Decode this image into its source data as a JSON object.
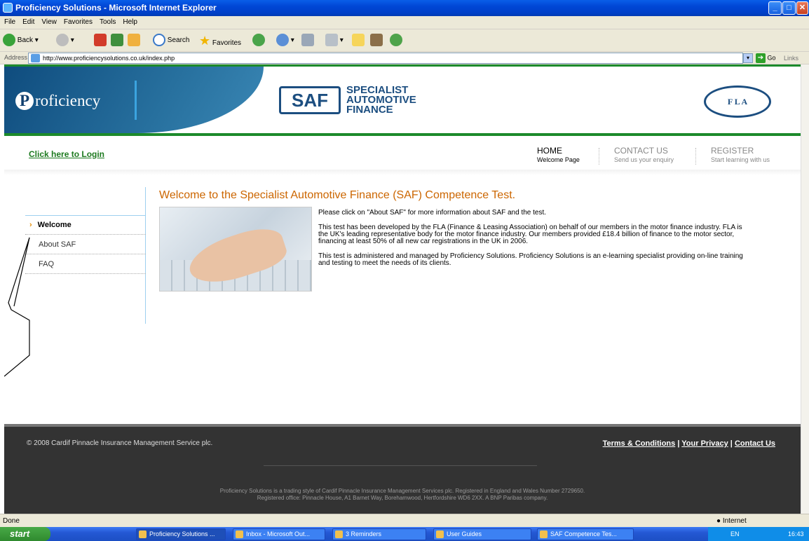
{
  "window": {
    "title": "Proficiency Solutions - Microsoft Internet Explorer"
  },
  "menu": [
    "File",
    "Edit",
    "View",
    "Favorites",
    "Tools",
    "Help"
  ],
  "toolbar": {
    "back": "Back",
    "search": "Search",
    "favorites": "Favorites"
  },
  "address": {
    "label": "Address",
    "url": "http://www.proficiencysolutions.co.uk/index.php",
    "go": "Go",
    "links": "Links"
  },
  "header": {
    "proficiency": "roficiency",
    "proficiency_initial": "P",
    "saf_logo": "SAF",
    "saf_line1": "SPECIALIST",
    "saf_line2": "AUTOMOTIVE",
    "saf_line3": "FINANCE",
    "fla": "F  L  A"
  },
  "login": "Click here to Login",
  "nav": [
    {
      "label": "HOME",
      "sub": "Welcome Page"
    },
    {
      "label": "CONTACT US",
      "sub": "Send us your enquiry"
    },
    {
      "label": "REGISTER",
      "sub": "Start learning with us"
    }
  ],
  "sidemenu": [
    {
      "label": "Welcome"
    },
    {
      "label": "About SAF"
    },
    {
      "label": "FAQ"
    }
  ],
  "main": {
    "heading": "Welcome to the Specialist Automotive Finance (SAF) Competence Test.",
    "p1": "Please click on \"About SAF\" for more information about SAF and the test.",
    "p2": "This test has been developed by the FLA (Finance & Leasing Association) on behalf of our members in the motor finance industry. FLA is the UK's leading representative body for the motor finance industry. Our members provided £18.4 billion of finance to the motor sector, financing at least 50% of all new car registrations in the UK in 2006.",
    "p3": "This test is administered and managed by Proficiency Solutions. Proficiency Solutions is an e-learning specialist providing on-line training and testing to meet the needs of its clients."
  },
  "footer": {
    "copyright": "© 2008 Cardif Pinnacle Insurance Management Service plc.",
    "terms": "Terms & Conditions",
    "privacy": "Your Privacy",
    "contact": "Contact Us",
    "sep": "|",
    "legal1": "Proficiency Solutions is a trading style of Cardif Pinnacle Insurance Management Services plc. Registered in England and Wales Number 2729650.",
    "legal2": "Registered office: Pinnacle House, A1 Barnet Way, Borehamwood, Hertfordshire WD6 2XX. A BNP Paribas company."
  },
  "status": {
    "left": "Done",
    "zone": "Internet"
  },
  "taskbar": {
    "start": "start",
    "tasks": [
      "Proficiency Solutions ...",
      "Inbox - Microsoft Out...",
      "3 Reminders",
      "User Guides",
      "SAF Competence Tes..."
    ],
    "lang": "EN",
    "clock": "16:43"
  }
}
